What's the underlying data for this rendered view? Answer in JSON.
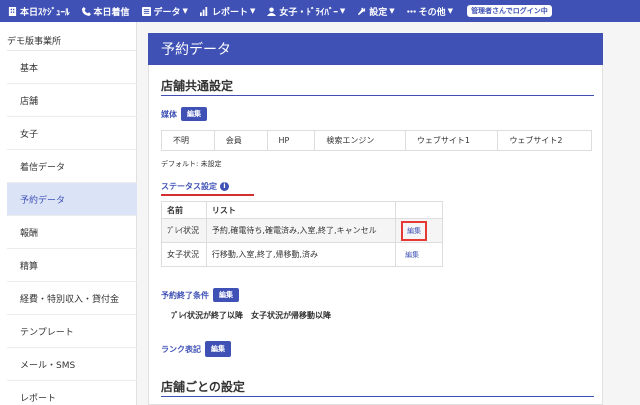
{
  "nav": {
    "items": [
      {
        "label": "本日ｽｹｼﾞｭｰﾙ",
        "icon": "building-icon",
        "caret": false
      },
      {
        "label": "本日着信",
        "icon": "phone-icon",
        "caret": false
      },
      {
        "label": "データ",
        "icon": "list-icon",
        "caret": true
      },
      {
        "label": "レポート",
        "icon": "chart-icon",
        "caret": true
      },
      {
        "label": "女子・ﾄﾞﾗｲﾊﾞｰ",
        "icon": "person-icon",
        "caret": true
      },
      {
        "label": "設定",
        "icon": "wrench-icon",
        "caret": true
      },
      {
        "label": "その他",
        "icon": "dots-icon",
        "caret": true
      }
    ],
    "login_badge": "管理者さんでログイン中"
  },
  "sidebar": {
    "office_name": "デモ版事業所",
    "items": [
      {
        "label": "基本"
      },
      {
        "label": "店舗"
      },
      {
        "label": "女子"
      },
      {
        "label": "着信データ"
      },
      {
        "label": "予約データ"
      },
      {
        "label": "報酬"
      },
      {
        "label": "精算"
      },
      {
        "label": "経費・特別収入・貸付金"
      },
      {
        "label": "テンプレート"
      },
      {
        "label": "メール・SMS"
      },
      {
        "label": "レポート"
      }
    ],
    "active_index": 4
  },
  "main": {
    "page_title": "予約データ",
    "common_section_title": "店舗共通設定",
    "media": {
      "label": "媒体",
      "edit_label": "編集",
      "options": [
        "不明",
        "会員",
        "HP",
        "検索エンジン",
        "ウェブサイト1",
        "ウェブサイト2"
      ],
      "default_note": "デフォルト: 未設定"
    },
    "status": {
      "label": "ステータス設定",
      "info_icon": "i",
      "headers": [
        "名前",
        "リスト",
        ""
      ],
      "rows": [
        {
          "name": "ﾌﾟﾚｲ状況",
          "list": "予約,確電待ち,確電済み,入室,終了,キャンセル",
          "edit": "編集"
        },
        {
          "name": "女子状況",
          "list": "行移動,入室,終了,帰移動,済み",
          "edit": "編集"
        }
      ]
    },
    "end_condition": {
      "label": "予約終了条件",
      "edit_label": "編集",
      "text": "ﾌﾟﾚｲ状況が終了以降　女子状況が帰移動以降"
    },
    "rank": {
      "label": "ランク表記",
      "edit_label": "編集"
    },
    "per_store_section_title": "店舗ごとの設定"
  },
  "colors": {
    "primary": "#3f51b5",
    "highlight": "#e53935",
    "active_bg": "#dbe4f7"
  }
}
